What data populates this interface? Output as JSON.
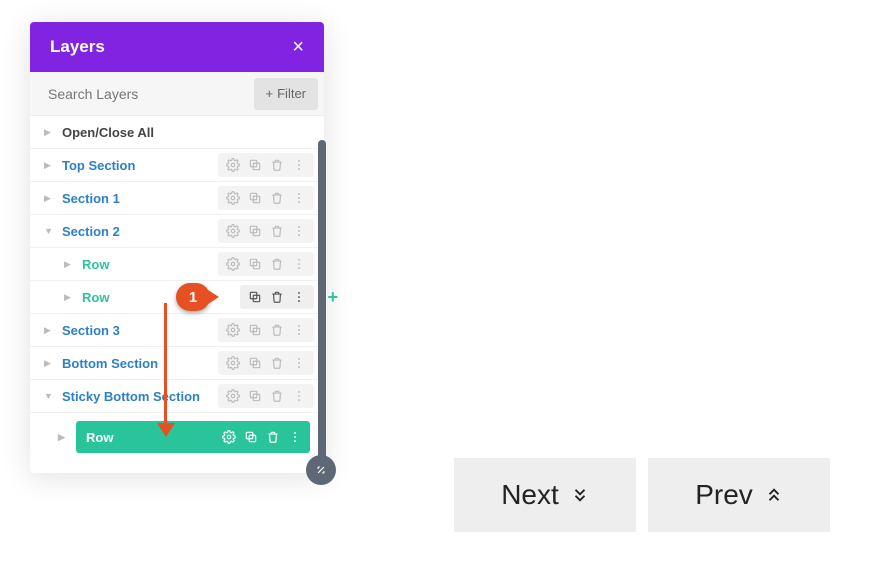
{
  "panel": {
    "title": "Layers",
    "search_placeholder": "Search Layers",
    "filter_label": "Filter",
    "open_close_label": "Open/Close All",
    "items": [
      {
        "label": "Top Section"
      },
      {
        "label": "Section 1"
      },
      {
        "label": "Section 2"
      },
      {
        "label": "Row",
        "child": true
      },
      {
        "label": "Row",
        "child": true,
        "active": true
      },
      {
        "label": "Section 3"
      },
      {
        "label": "Bottom Section"
      },
      {
        "label": "Sticky Bottom Section"
      }
    ],
    "highlight_label": "Row"
  },
  "callout": {
    "number": "1"
  },
  "nav": {
    "next": "Next",
    "prev": "Prev"
  }
}
